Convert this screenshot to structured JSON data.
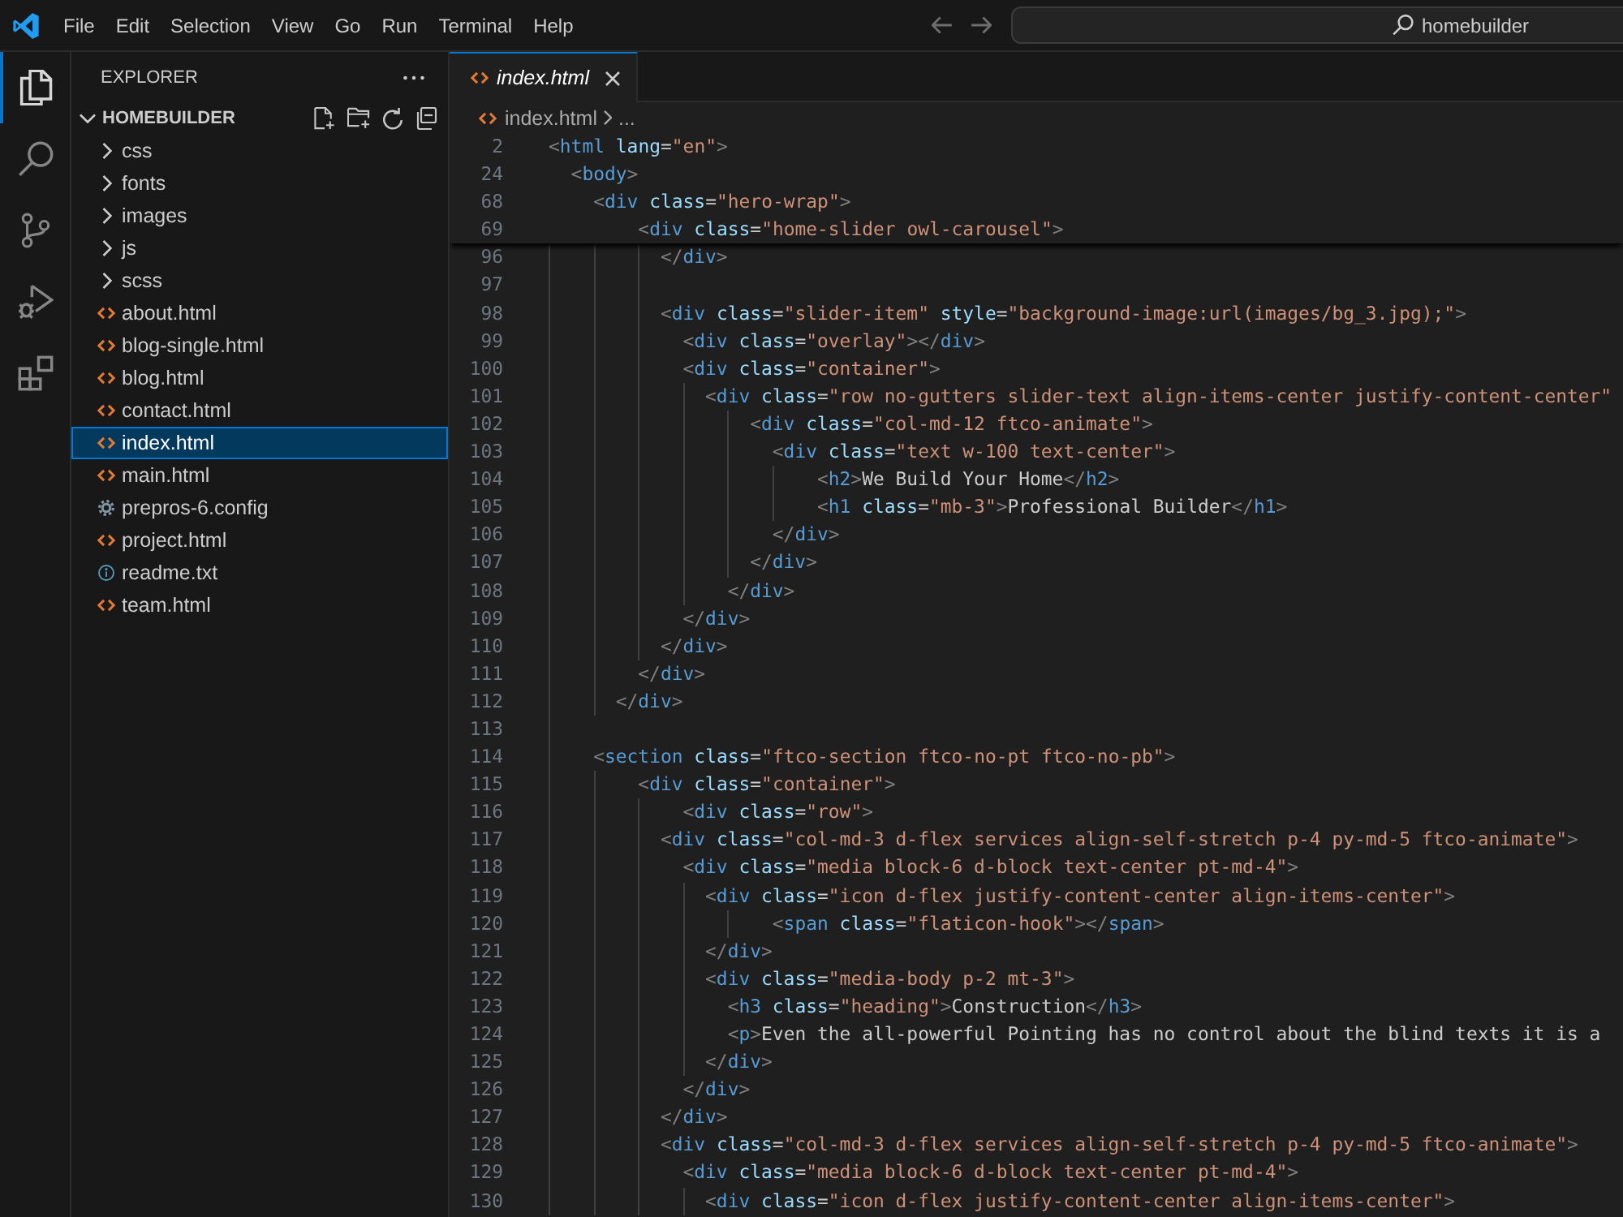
{
  "title_bar": {
    "menu": [
      "File",
      "Edit",
      "Selection",
      "View",
      "Go",
      "Run",
      "Terminal",
      "Help"
    ],
    "command_center": {
      "label": "homebuilder"
    }
  },
  "activity_bar": [
    {
      "kind": "explorer",
      "selected": true
    },
    {
      "kind": "search",
      "selected": false
    },
    {
      "kind": "source_control",
      "selected": false
    },
    {
      "kind": "run_debug",
      "selected": false
    },
    {
      "kind": "extensions",
      "selected": false
    }
  ],
  "sidebar": {
    "title": "EXPLORER",
    "folder": {
      "name": "HOMEBUILDER",
      "expanded": true
    },
    "items": [
      {
        "name": "css",
        "kind": "folder",
        "expanded": false,
        "selected": false
      },
      {
        "name": "fonts",
        "kind": "folder",
        "expanded": false,
        "selected": false
      },
      {
        "name": "images",
        "kind": "folder",
        "expanded": false,
        "selected": false
      },
      {
        "name": "js",
        "kind": "folder",
        "expanded": false,
        "selected": false
      },
      {
        "name": "scss",
        "kind": "folder",
        "expanded": false,
        "selected": false
      },
      {
        "name": "about.html",
        "kind": "html",
        "selected": false
      },
      {
        "name": "blog-single.html",
        "kind": "html",
        "selected": false
      },
      {
        "name": "blog.html",
        "kind": "html",
        "selected": false
      },
      {
        "name": "contact.html",
        "kind": "html",
        "selected": false
      },
      {
        "name": "index.html",
        "kind": "html",
        "selected": true
      },
      {
        "name": "main.html",
        "kind": "html",
        "selected": false
      },
      {
        "name": "prepros-6.config",
        "kind": "config",
        "selected": false
      },
      {
        "name": "project.html",
        "kind": "html",
        "selected": false
      },
      {
        "name": "readme.txt",
        "kind": "text",
        "selected": false
      },
      {
        "name": "team.html",
        "kind": "html",
        "selected": false
      }
    ]
  },
  "tabs": [
    {
      "label": "index.html",
      "kind": "html",
      "selected": true,
      "preview": true
    }
  ],
  "breadcrumbs": [
    {
      "label": "index.html",
      "kind": "html"
    },
    {
      "label": "..."
    }
  ],
  "editor": {
    "sticky_lines": [
      {
        "number": "2",
        "code": "<html lang=\"en\">"
      },
      {
        "number": "24",
        "code": "  <body>"
      },
      {
        "number": "68",
        "code": "    <div class=\"hero-wrap\">"
      },
      {
        "number": "69",
        "code": "        <div class=\"home-slider owl-carousel\">"
      }
    ],
    "lines": [
      {
        "number": "96",
        "code": "          </div>"
      },
      {
        "number": "97"
      },
      {
        "number": "98",
        "code": "          <div class=\"slider-item\" style=\"background-image:url(images/bg_3.jpg);\">"
      },
      {
        "number": "99",
        "code": "            <div class=\"overlay\"></div>"
      },
      {
        "number": "100",
        "code": "            <div class=\"container\">"
      },
      {
        "number": "101",
        "code": "              <div class=\"row no-gutters slider-text align-items-center justify-content-center\""
      },
      {
        "number": "102",
        "code": "                  <div class=\"col-md-12 ftco-animate\">"
      },
      {
        "number": "103",
        "code": "                    <div class=\"text w-100 text-center\">"
      },
      {
        "number": "104",
        "code": "                        <h2>We Build Your Home</h2>"
      },
      {
        "number": "105",
        "code": "                        <h1 class=\"mb-3\">Professional Builder</h1>"
      },
      {
        "number": "106",
        "code": "                    </div>"
      },
      {
        "number": "107",
        "code": "                  </div>"
      },
      {
        "number": "108",
        "code": "                </div>"
      },
      {
        "number": "109",
        "code": "            </div>"
      },
      {
        "number": "110",
        "code": "          </div>"
      },
      {
        "number": "111",
        "code": "        </div>"
      },
      {
        "number": "112",
        "code": "      </div>"
      },
      {
        "number": "113"
      },
      {
        "number": "114",
        "code": "    <section class=\"ftco-section ftco-no-pt ftco-no-pb\">"
      },
      {
        "number": "115",
        "code": "        <div class=\"container\">"
      },
      {
        "number": "116",
        "code": "            <div class=\"row\">"
      },
      {
        "number": "117",
        "code": "          <div class=\"col-md-3 d-flex services align-self-stretch p-4 py-md-5 ftco-animate\">"
      },
      {
        "number": "118",
        "code": "            <div class=\"media block-6 d-block text-center pt-md-4\">"
      },
      {
        "number": "119",
        "code": "              <div class=\"icon d-flex justify-content-center align-items-center\">"
      },
      {
        "number": "120",
        "code": "                    <span class=\"flaticon-hook\"></span>"
      },
      {
        "number": "121",
        "code": "              </div>"
      },
      {
        "number": "122",
        "code": "              <div class=\"media-body p-2 mt-3\">"
      },
      {
        "number": "123",
        "code": "                <h3 class=\"heading\">Construction</h3>"
      },
      {
        "number": "124",
        "code": "                <p>Even the all-powerful Pointing has no control about the blind texts it is a"
      },
      {
        "number": "125",
        "code": "              </div>"
      },
      {
        "number": "126",
        "code": "            </div>"
      },
      {
        "number": "127",
        "code": "          </div>"
      },
      {
        "number": "128",
        "code": "          <div class=\"col-md-3 d-flex services align-self-stretch p-4 py-md-5 ftco-animate\">"
      },
      {
        "number": "129",
        "code": "            <div class=\"media block-6 d-block text-center pt-md-4\">"
      },
      {
        "number": "130",
        "code": "              <div class=\"icon d-flex justify-content-center align-items-center\">"
      }
    ]
  }
}
